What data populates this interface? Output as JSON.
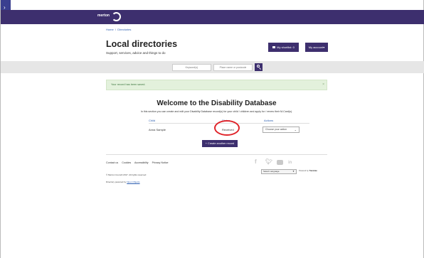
{
  "header": {
    "logo_text": "merton",
    "breadcrumb": [
      "Home",
      "Directories"
    ],
    "title": "Local directories",
    "subtitle": "Support, services, advice and things to do",
    "shortlist_label": "My shortlist: 0",
    "account_label": "My account"
  },
  "search": {
    "keyword_placeholder": "Keyword(s)",
    "location_placeholder": "Place name or postcode"
  },
  "alert": {
    "message": "Your record has been saved.",
    "close": "×"
  },
  "main": {
    "title": "Welcome to the Disability Database",
    "intro": "In this section you can create and edit your Disability Database record(s) for your child / children and apply for / renew their M-Card(s).",
    "columns": [
      "Child",
      "Status",
      "Actions"
    ],
    "rows": [
      {
        "child": "Anna Sample",
        "status": "Received",
        "action": "Choose your action"
      }
    ],
    "create_label": "+ Create another record"
  },
  "footer": {
    "links": [
      "Contact us",
      "Cookies",
      "Accessibility",
      "Privacy Notice"
    ],
    "copyright": "© Merton Council 2017. All rights reserved",
    "powered_prefix": "Directory powered by",
    "powered_link": "Open Objects",
    "language_label": "Select Language",
    "translate_prefix": "Powered by",
    "translate_brand": "Translate"
  },
  "icons": {
    "sidebar_arrow": "chevron-right-icon",
    "shortlist": "list-icon",
    "search": "search-icon",
    "facebook": "facebook-icon",
    "twitter": "twitter-icon",
    "youtube": "youtube-icon",
    "linkedin": "linkedin-icon"
  },
  "colors": {
    "brand": "#3d2f6e",
    "alert_bg": "#e3f1dc",
    "alert_text": "#3c763d",
    "link": "#2a5db0",
    "highlight": "#e0242a"
  }
}
